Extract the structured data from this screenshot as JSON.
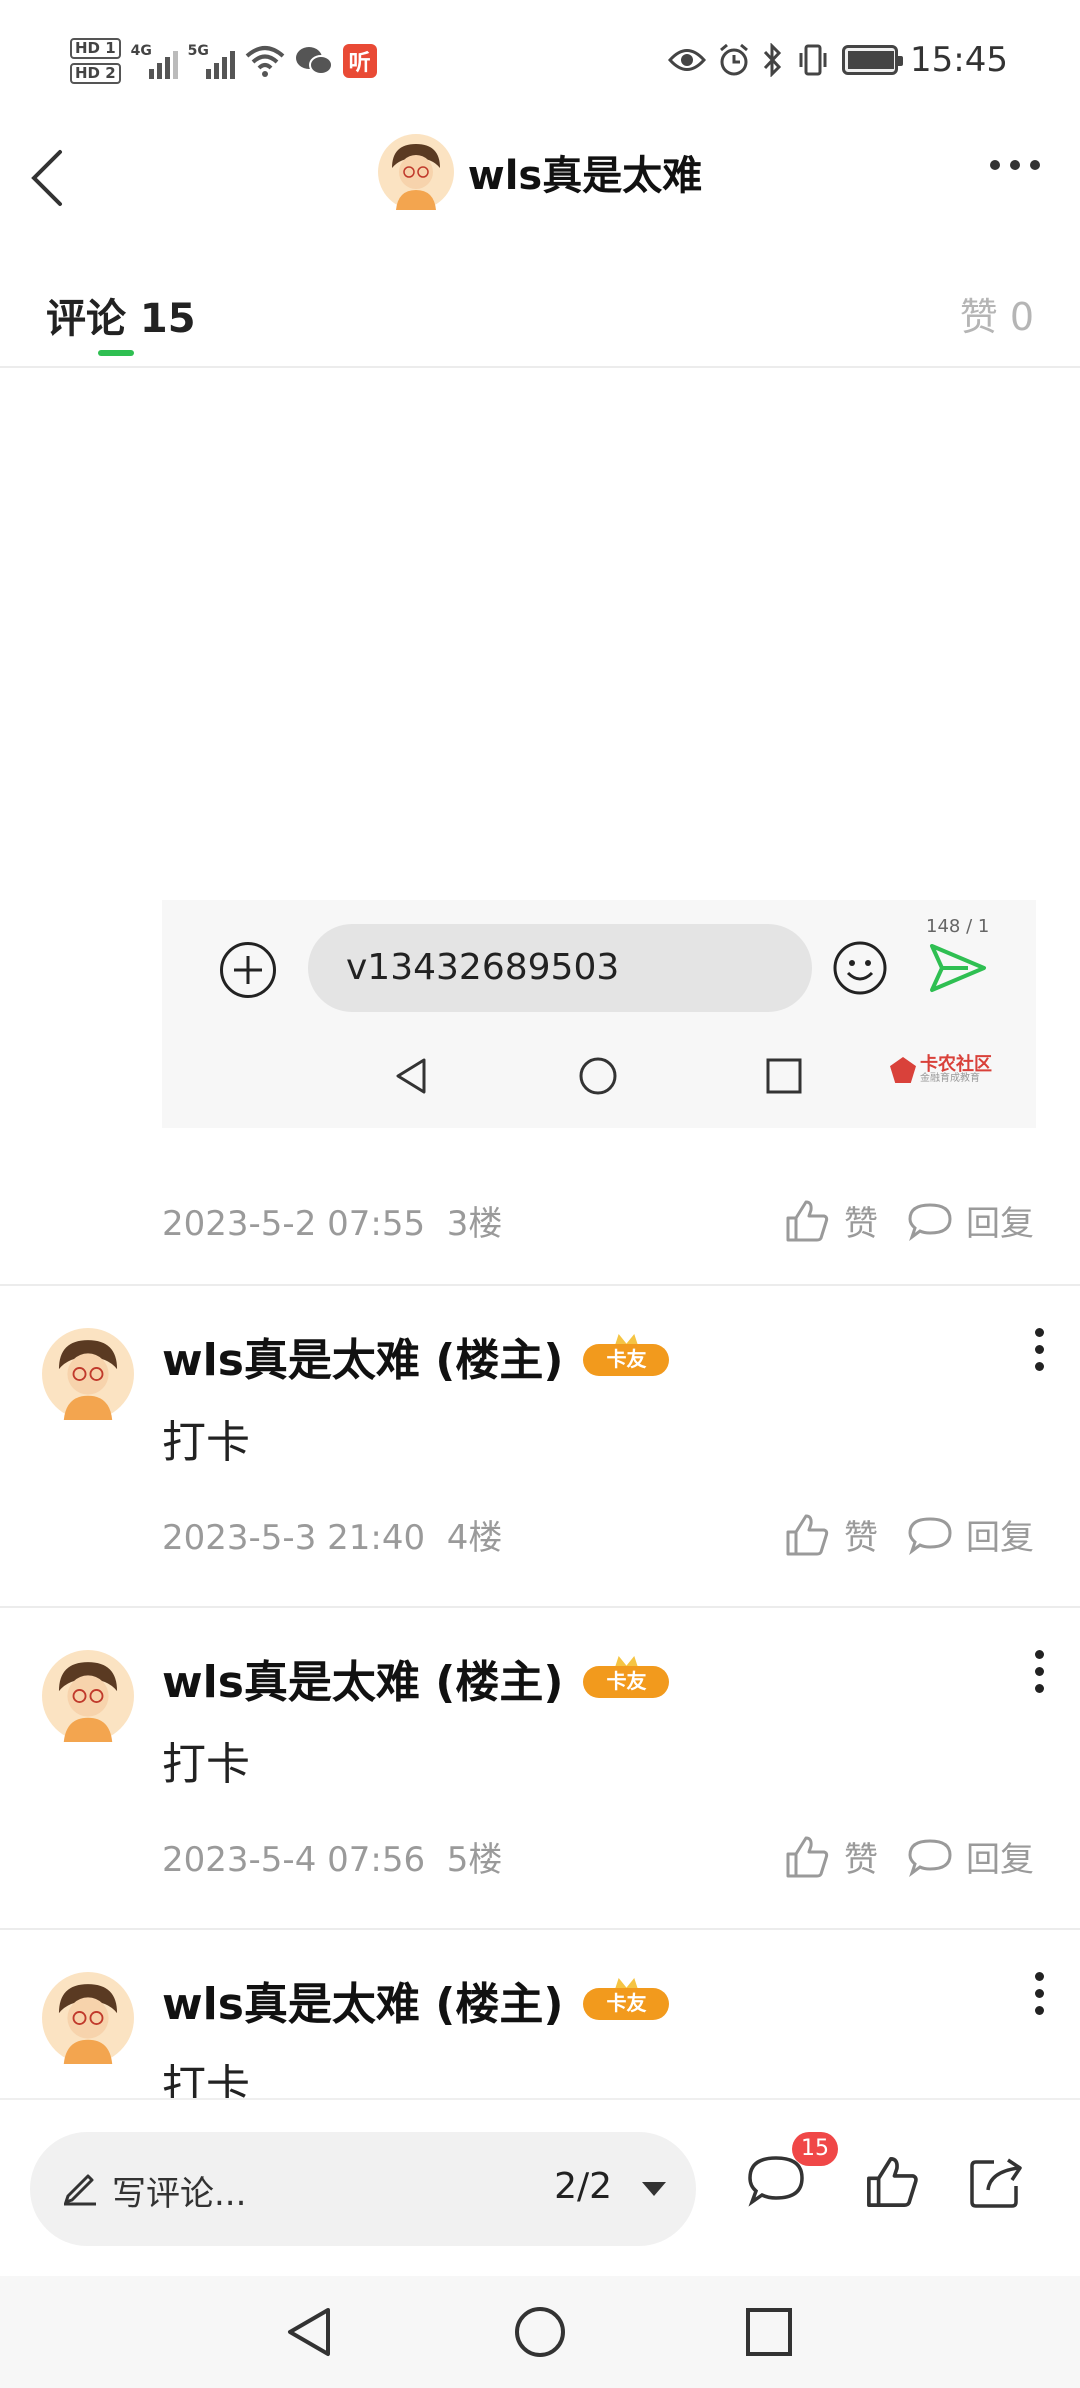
{
  "status_bar": {
    "hd1": "HD 1",
    "hd2": "HD 2",
    "network1": "4G",
    "network2": "5G",
    "app_badge": "听",
    "time": "15:45"
  },
  "header": {
    "title": "wls真是太难"
  },
  "tabs": {
    "comments_label": "评论 15",
    "likes_label": "赞 0"
  },
  "embedded_input": {
    "value": "v13432689503",
    "counter": "148 / 1",
    "logo_title": "卡农社区",
    "logo_sub": "金融育成教育"
  },
  "first_meta": {
    "date": "2023-5-2 07:55",
    "floor": "3楼",
    "like_label": "赞",
    "reply_label": "回复"
  },
  "comments": [
    {
      "name": "wls真是太难 (楼主)",
      "badge": "卡友",
      "body": "打卡",
      "date": "2023-5-3 21:40",
      "floor": "4楼",
      "like_label": "赞",
      "reply_label": "回复"
    },
    {
      "name": "wls真是太难 (楼主)",
      "badge": "卡友",
      "body": "打卡",
      "date": "2023-5-4 07:56",
      "floor": "5楼",
      "like_label": "赞",
      "reply_label": "回复"
    },
    {
      "name": "wls真是太难 (楼主)",
      "badge": "卡友",
      "body": "打卡"
    }
  ],
  "bottom_bar": {
    "write_placeholder": "写评论...",
    "page_indicator": "2/2",
    "comment_count": "15"
  },
  "colors": {
    "accent": "#2fbf52",
    "badge": "#f04747",
    "crown": "#f29a1d"
  }
}
